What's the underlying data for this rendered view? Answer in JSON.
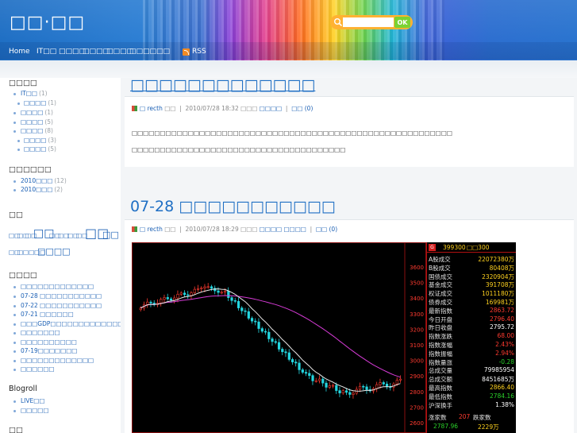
{
  "header": {
    "site_title": "□□·□□",
    "search": {
      "placeholder": "",
      "button_label": "OK"
    },
    "nav": [
      {
        "label": "Home"
      },
      {
        "label": "IT□□"
      },
      {
        "label": "□□□□"
      },
      {
        "label": "□□□□"
      },
      {
        "label": "□□□□"
      },
      {
        "label": "□□□□□□"
      }
    ],
    "rss_label": "RSS"
  },
  "sidebar": {
    "categories": {
      "heading": "□□□□",
      "items": [
        {
          "label": "IT□□",
          "count": "(1)",
          "level": 0
        },
        {
          "label": "□□□□",
          "count": "(1)",
          "level": 1
        },
        {
          "label": "□□□□",
          "count": "(1)",
          "level": 0
        },
        {
          "label": "□□□□",
          "count": "(5)",
          "level": 0
        },
        {
          "label": "□□□□",
          "count": "(8)",
          "level": 0
        },
        {
          "label": "□□□□",
          "count": "(3)",
          "level": 1
        },
        {
          "label": "□□□□",
          "count": "(5)",
          "level": 1
        }
      ]
    },
    "archives": {
      "heading": "□□□□□□",
      "items": [
        {
          "label": "2010□□□",
          "count": "(12)"
        },
        {
          "label": "2010□□□",
          "count": "(2)"
        }
      ]
    },
    "tags": {
      "heading": "□□",
      "items": [
        {
          "label": "□□",
          "size": "small"
        },
        {
          "label": "□□",
          "size": "small"
        },
        {
          "label": "□□",
          "size": "small"
        },
        {
          "label": "□□",
          "size": "large"
        },
        {
          "label": "□□",
          "size": "small"
        },
        {
          "label": "□□",
          "size": "small"
        },
        {
          "label": "□□",
          "size": "small"
        },
        {
          "label": "□□",
          "size": "xlarge"
        },
        {
          "label": "□□",
          "size": "medium"
        },
        {
          "label": "□□",
          "size": "small"
        },
        {
          "label": "□",
          "size": "small"
        },
        {
          "label": "□□□□",
          "size": "small"
        },
        {
          "label": "□□□□",
          "size": "medium"
        }
      ]
    },
    "recent": {
      "heading": "□□□□",
      "items": [
        {
          "label": "□□□□□□□□□□□□□"
        },
        {
          "label": "07-28 □□□□□□□□□□□"
        },
        {
          "label": "07-22 □□□□□□□□□□□"
        },
        {
          "label": "07-21 □□□□□□"
        },
        {
          "label": "□□□GDP□□□□□□□□□□□□□□□"
        },
        {
          "label": "□□□□□□□"
        },
        {
          "label": "□□□□□□□□□□"
        },
        {
          "label": "07-19□□□□□□□"
        },
        {
          "label": "□□□□□□□□□□□□□"
        },
        {
          "label": "□□□□□□"
        }
      ]
    },
    "blogroll": {
      "heading": "Blogroll",
      "items": [
        {
          "label": "LIVE□□"
        },
        {
          "label": "□□□□□"
        }
      ]
    },
    "extra_heading": "□□"
  },
  "posts": [
    {
      "title": "□□□□□□□□□□□□□",
      "meta": {
        "by": "□ recth",
        "suffix": "□□",
        "date": "2010/07/28 18:32",
        "cat_prefix": "□□□",
        "category": "□□□□",
        "comments": "□□ (0)"
      },
      "paragraphs": [
        "□□□□□□□□□□□□□□□□□□□□□□□□□□□□□□□□□□□□□□□□□□□□□□□□□□□□□□□□□",
        "□□□□□□□□□□□□□□□□□□□□□□□□□□□□□□□□□□□□□□"
      ]
    },
    {
      "title": "07-28 □□□□□□□□□□□",
      "meta": {
        "by": "□ recth",
        "suffix": "□□",
        "date": "2010/07/28 18:29",
        "cat_prefix": "□□□",
        "category": "□□□□",
        "category2": "□□□□",
        "comments": "□□ (0)"
      }
    }
  ],
  "stock_quote": {
    "code": "399300",
    "name": "□□300",
    "tag": "G",
    "y_axis_ticks": [
      "3600",
      "3500",
      "3400",
      "3300",
      "3200",
      "3100",
      "3000",
      "2900",
      "2800",
      "2700",
      "2600"
    ],
    "rows": [
      {
        "label": "A股成交",
        "value": "22072380万"
      },
      {
        "label": "B股成交",
        "value": "80408万"
      },
      {
        "label": "国债成交",
        "value": "2320904万"
      },
      {
        "label": "基金成交",
        "value": "391708万"
      },
      {
        "label": "权证成交",
        "value": "1011180万"
      },
      {
        "label": "债券成交",
        "value": "169981万"
      },
      {
        "label": "最新指数",
        "value": "2863.72"
      },
      {
        "label": "今日开盘",
        "value": "2796.40"
      },
      {
        "label": "昨日收盘",
        "value": "2795.72"
      },
      {
        "label": "指数涨跌",
        "value": "68.00"
      },
      {
        "label": "指数涨幅",
        "value": "2.43%"
      },
      {
        "label": "指数振幅",
        "value": "2.94%"
      },
      {
        "label": "指数量涨",
        "value": "-0.28"
      },
      {
        "label": "总成交量",
        "value": "79985954"
      },
      {
        "label": "总成交额",
        "value": "8451685万"
      },
      {
        "label": "最高指数",
        "value": "2866.40"
      },
      {
        "label": "最低指数",
        "value": "2784.16"
      },
      {
        "label": "沪深换手",
        "value": "1.38%"
      }
    ],
    "footer": {
      "up_label": "涨家数",
      "up_count": "207",
      "down_label": "跌家数",
      "bottom_left": "2787.96",
      "bottom_right": "2229万"
    }
  },
  "colors": {
    "link": "#1a5fb4",
    "title": "#1f6fc4",
    "quote_yellow": "#ffd21f",
    "quote_red": "#ff3b30"
  }
}
